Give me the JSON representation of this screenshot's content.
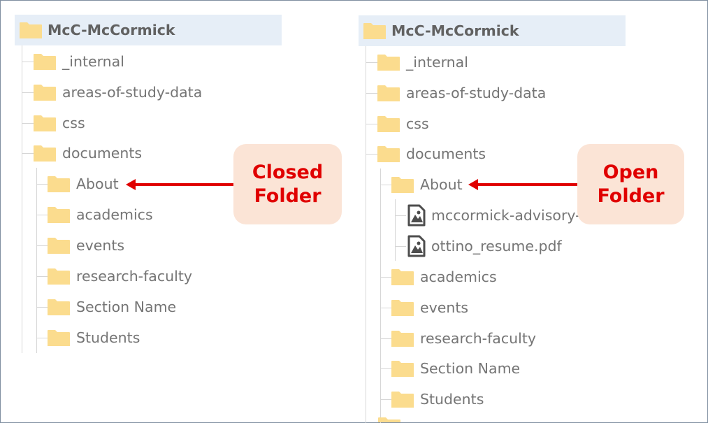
{
  "left_panel": {
    "root": {
      "label": "McC-McCormick",
      "icon": "folder-icon"
    },
    "children": [
      {
        "label": "_internal",
        "icon": "folder-icon"
      },
      {
        "label": "areas-of-study-data",
        "icon": "folder-icon"
      },
      {
        "label": "css",
        "icon": "folder-icon"
      },
      {
        "label": "documents",
        "icon": "folder-icon"
      }
    ],
    "documents_children": [
      {
        "label": "About",
        "icon": "folder-icon"
      },
      {
        "label": "academics",
        "icon": "folder-icon"
      },
      {
        "label": "events",
        "icon": "folder-icon"
      },
      {
        "label": "research-faculty",
        "icon": "folder-icon"
      },
      {
        "label": "Section Name",
        "icon": "folder-icon"
      },
      {
        "label": "Students",
        "icon": "folder-icon"
      }
    ],
    "callout": {
      "line1": "Closed",
      "line2": "Folder"
    }
  },
  "right_panel": {
    "root": {
      "label": "McC-McCormick",
      "icon": "folder-icon"
    },
    "children": [
      {
        "label": "_internal",
        "icon": "folder-icon"
      },
      {
        "label": "areas-of-study-data",
        "icon": "folder-icon"
      },
      {
        "label": "css",
        "icon": "folder-icon"
      },
      {
        "label": "documents",
        "icon": "folder-icon"
      }
    ],
    "about": {
      "label": "About",
      "icon": "folder-icon"
    },
    "about_files": [
      {
        "label": "mccormick-advisory-",
        "icon": "pdf-file-icon"
      },
      {
        "label": "ottino_resume.pdf",
        "icon": "pdf-file-icon"
      }
    ],
    "documents_children": [
      {
        "label": "academics",
        "icon": "folder-icon"
      },
      {
        "label": "events",
        "icon": "folder-icon"
      },
      {
        "label": "research-faculty",
        "icon": "folder-icon"
      },
      {
        "label": "Section Name",
        "icon": "folder-icon"
      },
      {
        "label": "Students",
        "icon": "folder-icon"
      }
    ],
    "callout": {
      "line1": "Open",
      "line2": "Folder"
    }
  },
  "colors": {
    "folder": "#fbdc8e",
    "folder_tab": "#f8d57e",
    "root_highlight": "#e6eef7",
    "callout_bg": "#fbe4d6",
    "callout_text": "#e00000",
    "arrow": "#e00000",
    "label_text": "#757575",
    "frame_border": "#7f8ea0"
  }
}
